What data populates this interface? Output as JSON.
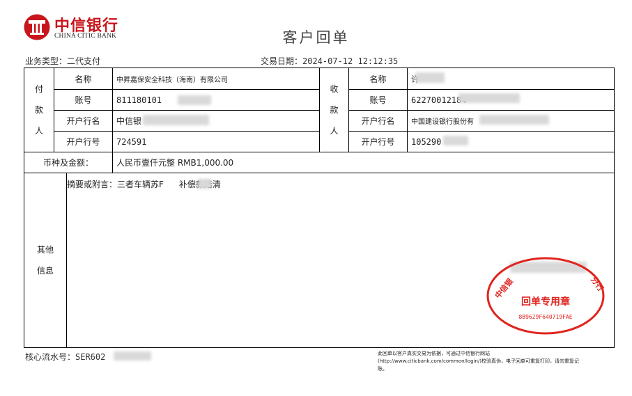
{
  "header": {
    "bank_name_cn": "中信银行",
    "bank_name_en": "CHINA CITIC BANK",
    "title": "客户回单"
  },
  "meta": {
    "business_type": "业务类型：二代支付",
    "trade_date": "交易日期：2024-07-12 12:12:35"
  },
  "payer": {
    "group_label": [
      "付",
      "款",
      "人"
    ],
    "name_label": "名称",
    "name_value": "中昇嘉保安全科技（海南）有限公司",
    "account_label": "账号",
    "account_value": "811180101",
    "bank_label": "开户行名",
    "bank_value": "中信银",
    "bank_no_label": "开户行号",
    "bank_no_value": "724591"
  },
  "payee": {
    "group_label": [
      "收",
      "款",
      "人"
    ],
    "name_label": "名称",
    "name_value": "许",
    "account_label": "账号",
    "account_value": "62270012184",
    "bank_label": "开户行名",
    "bank_value": "中国建设银行股份有",
    "bank_no_label": "开户行号",
    "bank_no_value": "105290"
  },
  "amount": {
    "label": "币种及金额：",
    "value": "人民币壹仟元整   RMB1,000.00"
  },
  "other": {
    "label": [
      "其他",
      "信息"
    ],
    "remark_prefix": "摘要或附言：三者车辆苏F",
    "remark_suffix": "补偿款结清"
  },
  "footer": {
    "serial": "核心流水号：SER602",
    "note": "此回单以客户真实交易为依据，可通过中信银行网站(http://www.citicbank.com/common/login/)校验真伪，电子回单可重复打印，请勿重复记账。"
  },
  "seal": {
    "title": "回单专用章",
    "code": "8B9629F640719FAE",
    "ring_left": "中信银",
    "ring_right": "分行",
    "color": "#e0241f"
  },
  "colors": {
    "brand": "#c8161d",
    "border": "#000000"
  }
}
